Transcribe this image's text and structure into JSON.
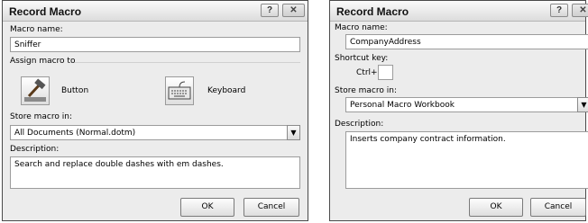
{
  "dialog1": {
    "title": "Record Macro",
    "help_glyph": "?",
    "close_glyph": "✕",
    "macro_name_label": "Macro name:",
    "macro_name_value": "Sniffer",
    "assign_label": "Assign macro to",
    "button_label": "Button",
    "keyboard_label": "Keyboard",
    "store_label": "Store macro in:",
    "store_value": "All Documents (Normal.dotm)",
    "description_label": "Description:",
    "description_value": "Search and replace double dashes with em dashes.",
    "ok_label": "OK",
    "cancel_label": "Cancel"
  },
  "dialog2": {
    "title": "Record Macro",
    "help_glyph": "?",
    "close_glyph": "✕",
    "macro_name_label": "Macro name:",
    "macro_name_value": "CompanyAddress",
    "shortcut_label": "Shortcut key:",
    "ctrl_label": "Ctrl+",
    "shortcut_value": "",
    "store_label": "Store macro in:",
    "store_value": "Personal Macro Workbook",
    "description_label": "Description:",
    "description_value": "Inserts company contract information.",
    "ok_label": "OK",
    "cancel_label": "Cancel"
  }
}
